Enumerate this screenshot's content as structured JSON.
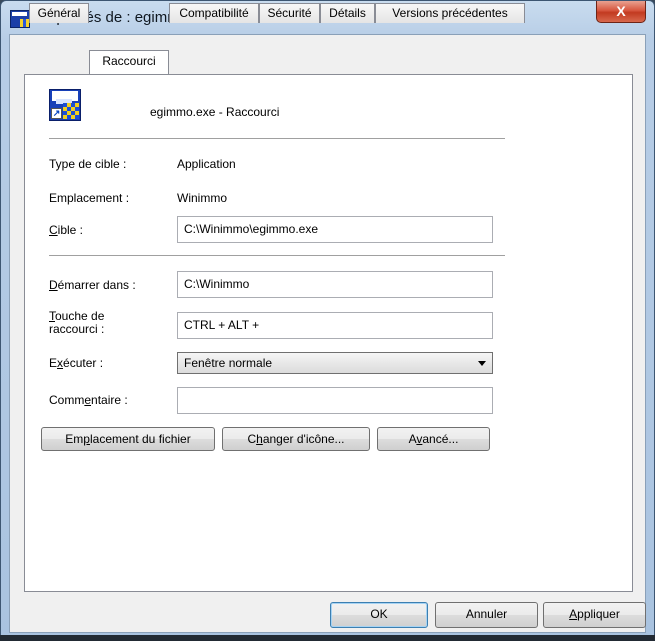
{
  "window": {
    "title": "Propriétés de : egimmo.exe - Raccourci",
    "close_glyph": "X"
  },
  "tabs": [
    {
      "label": "Général",
      "active": false
    },
    {
      "label": "Raccourci",
      "active": true
    },
    {
      "label": "Compatibilité",
      "active": false
    },
    {
      "label": "Sécurité",
      "active": false
    },
    {
      "label": "Détails",
      "active": false
    },
    {
      "label": "Versions précédentes",
      "active": false
    }
  ],
  "shortcut": {
    "name": "egimmo.exe - Raccourci",
    "icon": "egimmo-euro-icon",
    "type_label": "Type de cible :",
    "type_value": "Application",
    "location_label": "Emplacement :",
    "location_value": "Winimmo",
    "target_label": {
      "accel": "C",
      "rest": "ible :"
    },
    "target_value": "C:\\Winimmo\\egimmo.exe",
    "start_label": {
      "accel": "D",
      "rest": "émarrer dans :"
    },
    "start_value": "C:\\Winimmo",
    "hotkey_label": {
      "accel": "T",
      "rest": "ouche de",
      "line2": "raccourci :"
    },
    "hotkey_value": "CTRL + ALT +",
    "run_label": {
      "pre": "E",
      "accel": "x",
      "rest": "écuter :"
    },
    "run_value": "Fenêtre normale",
    "comment_label": {
      "pre": "Comm",
      "accel": "e",
      "rest": "ntaire :"
    },
    "comment_value": ""
  },
  "actions": {
    "open_location": {
      "pre": "Em",
      "accel": "p",
      "rest": "lacement du fichier"
    },
    "change_icon": {
      "pre": "C",
      "accel": "h",
      "rest": "anger d'icône..."
    },
    "advanced": {
      "pre": "A",
      "accel": "v",
      "rest": "ancé..."
    }
  },
  "footer": {
    "ok": "OK",
    "cancel": "Annuler",
    "apply": {
      "accel": "A",
      "rest": "ppliquer"
    }
  },
  "colors": {
    "titlebar": "#b7cde6",
    "close_button": "#c9462c",
    "panel_bg": "#ffffff",
    "dialog_bg": "#f0f0f0"
  }
}
